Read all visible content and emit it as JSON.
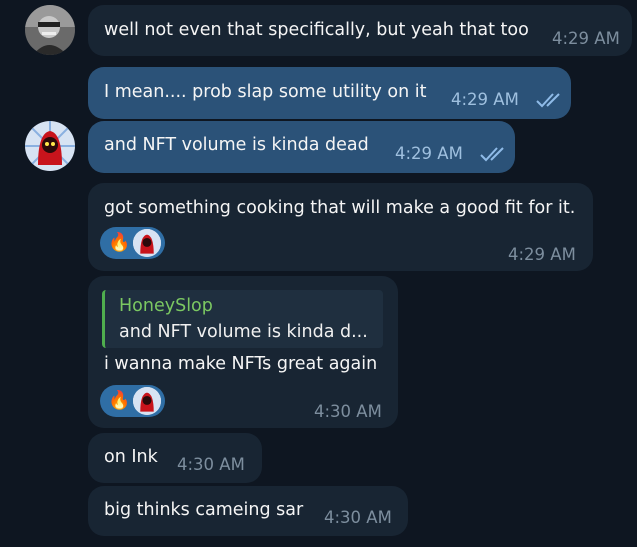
{
  "messages": [
    {
      "text": "well not even that specifically, but yeah that too",
      "time": "4:29 AM"
    },
    {
      "text": "I mean.... prob slap some utility on it",
      "time": "4:29 AM"
    },
    {
      "text": "and NFT volume is kinda dead",
      "time": "4:29 AM"
    },
    {
      "text": "got something cooking that will make a good fit for it.",
      "time": "4:29 AM",
      "reaction": "🔥"
    },
    {
      "reply": {
        "author": "HoneySlop",
        "preview": "and NFT volume is kinda d..."
      },
      "text": "i wanna make NFTs great again",
      "time": "4:30 AM",
      "reaction": "🔥"
    },
    {
      "text": "on Ink",
      "time": "4:30 AM"
    },
    {
      "text": "big thinks cameing sar",
      "time": "4:30 AM"
    }
  ],
  "colors": {
    "background": "#0e1621",
    "incoming": "#182533",
    "outgoing": "#2b5278",
    "reply_accent": "#4fae4e"
  }
}
